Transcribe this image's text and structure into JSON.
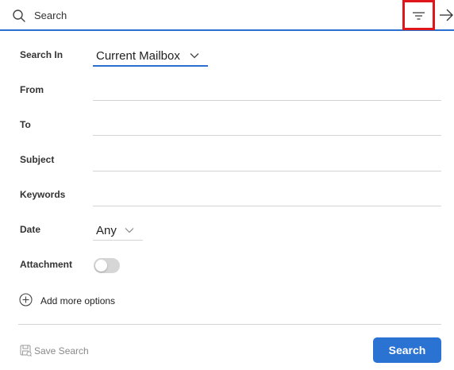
{
  "search_bar": {
    "placeholder": "Search",
    "search_icon": "search-icon",
    "filter_icon": "filter-icon",
    "forward_icon": "arrow-right-icon",
    "highlight_color": "#e0161d",
    "accent_color": "#2b6fcf"
  },
  "form": {
    "search_in": {
      "label": "Search In",
      "value": "Current Mailbox"
    },
    "from": {
      "label": "From",
      "value": ""
    },
    "to": {
      "label": "To",
      "value": ""
    },
    "subject": {
      "label": "Subject",
      "value": ""
    },
    "keywords": {
      "label": "Keywords",
      "value": ""
    },
    "date": {
      "label": "Date",
      "value": "Any"
    },
    "attachment": {
      "label": "Attachment",
      "enabled": false
    }
  },
  "add_more": {
    "label": "Add more options",
    "icon": "plus-circle-icon"
  },
  "footer": {
    "save_search_label": "Save Search",
    "save_icon": "save-icon",
    "search_button_label": "Search",
    "button_color": "#2a73d3"
  }
}
